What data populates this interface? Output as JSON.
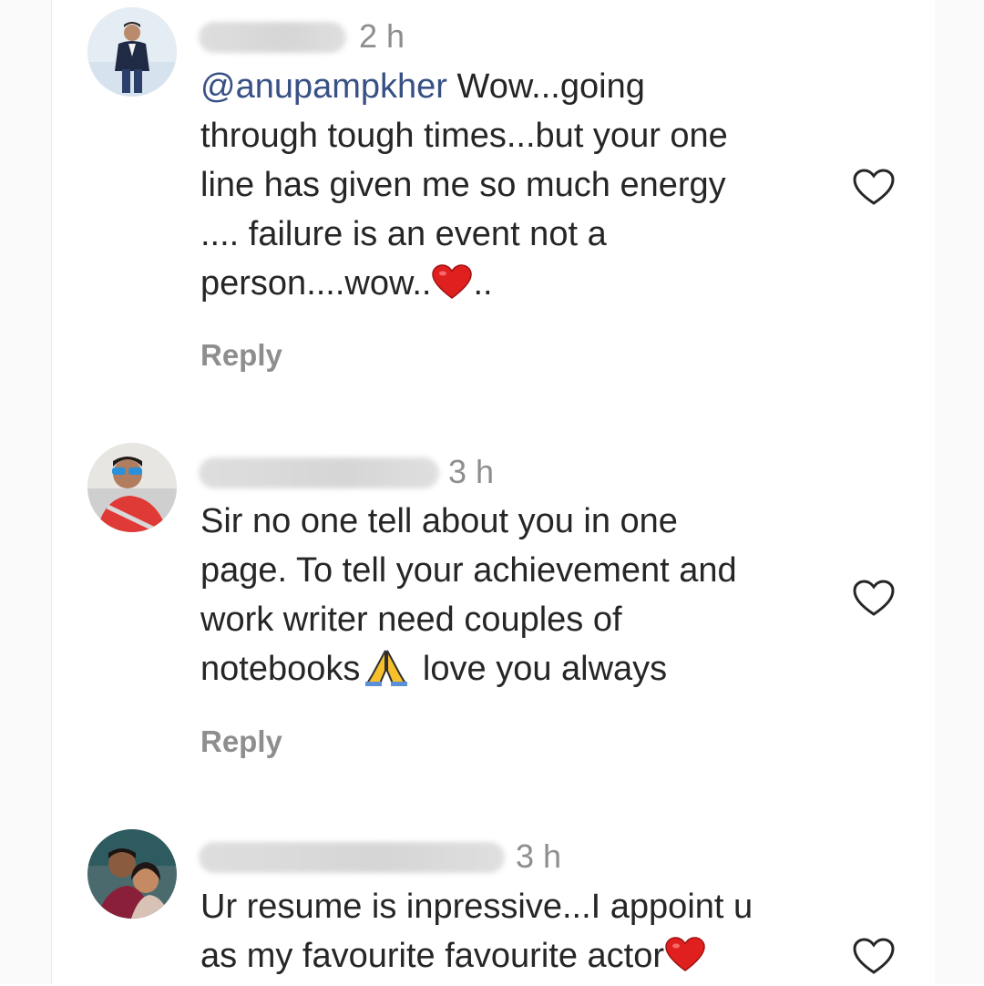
{
  "comments": [
    {
      "time": "2 h",
      "mention": "@anupampkher",
      "text_lines": [
        " Wow...going",
        "through tough times...but your one",
        "line has given me so much energy",
        ".... failure is an event not a",
        "person....wow.."
      ],
      "text_after_emoji": "..",
      "emoji": "red-heart",
      "reply_label": "Reply",
      "avatar": "avatar-man-in-suit"
    },
    {
      "time": "3 h",
      "text_lines": [
        "Sir no one tell about you in one",
        "page. To tell your achievement and",
        "work writer need couples of",
        "notebooks"
      ],
      "emoji": "folded-hands",
      "text_after_emoji": " love you always",
      "reply_label": "Reply",
      "avatar": "avatar-man-sunglasses"
    },
    {
      "time": "3 h",
      "text_lines": [
        "Ur resume is inpressive...I appoint u",
        "as my favourite favourite actor"
      ],
      "emoji": "red-heart",
      "avatar": "avatar-couple"
    }
  ],
  "colors": {
    "text": "#262626",
    "muted": "#8e8e8e",
    "mention": "#385185",
    "heart_red": "#e0201f"
  }
}
